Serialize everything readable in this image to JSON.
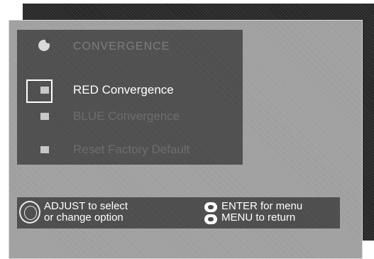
{
  "menu": {
    "title": "CONVERGENCE",
    "items": [
      {
        "label": "RED Convergence",
        "state": "selected"
      },
      {
        "label": "BLUE Convergence",
        "state": "dim"
      },
      {
        "label": "Reset Factory Default",
        "state": "dim"
      }
    ]
  },
  "help": {
    "adjust_line1": "ADJUST  to select",
    "adjust_line2": "or change option",
    "enter_line": "ENTER for menu",
    "menu_line": "MENU to return"
  },
  "icons": {
    "title": "convergence-icon",
    "item": "square-bullet-icon",
    "adjust": "adjust-dial-icon",
    "enter": "enter-button-icon",
    "menu": "menu-button-icon"
  },
  "colors": {
    "menu_background": "#4d4d4d",
    "panel_background": "#9c9c9c",
    "selected_text": "#ffffff",
    "dim_text": "#6d6d6d"
  }
}
